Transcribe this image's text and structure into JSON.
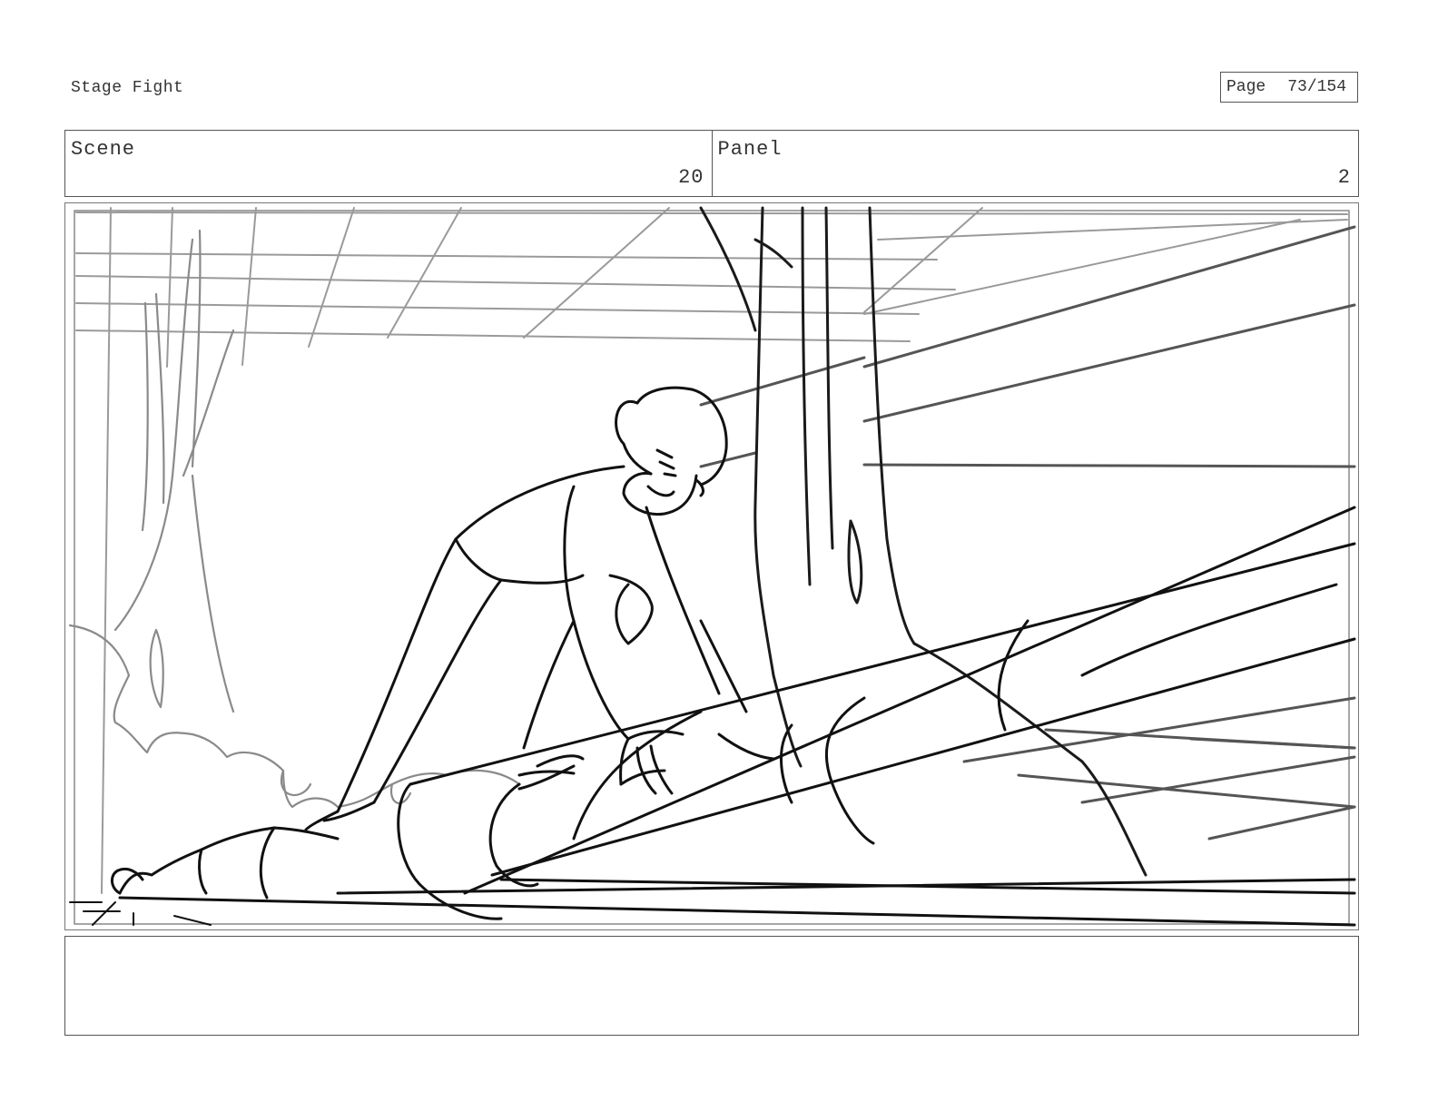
{
  "header": {
    "project_title": "Stage Fight",
    "page_label": "Page",
    "page_number": "73/154"
  },
  "scene": {
    "label": "Scene",
    "value": "20"
  },
  "panel": {
    "label": "Panel",
    "value": "2"
  },
  "artwork": {
    "description_icon": "storyboard-sketch-icon"
  },
  "notes": {
    "text": ""
  }
}
